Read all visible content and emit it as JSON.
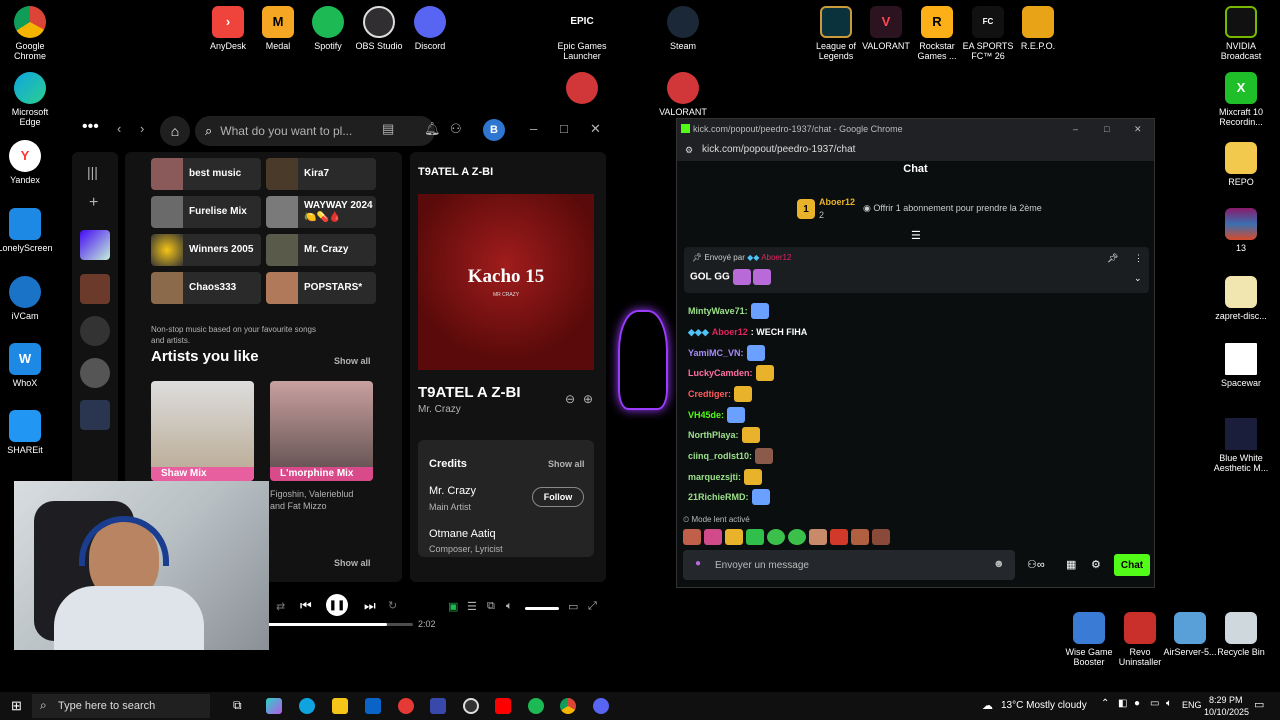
{
  "desktop": {
    "left_icons": [
      "Google Chrome",
      "Microsoft Edge",
      "Yandex",
      "LonelyScreen",
      "iVCam",
      "WhoX",
      "SHAREit"
    ],
    "top_icons": [
      "AnyDesk",
      "Medal",
      "Spotify",
      "OBS Studio",
      "Discord",
      "Epic Games Launcher",
      "Steam",
      "League of Legends",
      "VALORANT",
      "Rockstar Games ...",
      "EA SPORTS FC™ 26",
      "R.E.P.O."
    ],
    "mid_icons": [
      "VALORANT"
    ],
    "right_icons": [
      "NVIDIA Broadcast",
      "Mixcraft 10 Recordin...",
      "REPO",
      "13",
      "zapret-disc...",
      "Spacewar",
      "Blue White Aesthetic M..."
    ],
    "bottom_icons": [
      "Wise Game Booster",
      "Revo Uninstaller",
      "AirServer-5...",
      "Recycle Bin"
    ]
  },
  "spotify": {
    "search_placeholder": "What do you want to pl...",
    "avatar": "B",
    "grid": [
      "best music",
      "Kira7",
      "Furelise Mix",
      "WAYWAY 2024 🍋💊🩸",
      "Winners 2005",
      "Mr. Crazy",
      "Chaos333",
      "POPSTARS*"
    ],
    "subtext": "Non-stop music based on your favourite songs and artists.",
    "artists_heading": "Artists you like",
    "show_all": "Show all",
    "artist_mixes": [
      "Shaw Mix",
      "L'morphine Mix"
    ],
    "mix_desc": "Figoshin, Valerieblud and Fat Mizzo",
    "show_all_2": "Show all",
    "now_playing": {
      "header": "T9ATEL A Z-BI",
      "cover_text": "Kacho 15",
      "cover_sub": "MR CRAZY",
      "title": "T9ATEL A Z-BI",
      "artist": "Mr. Crazy"
    },
    "credits": {
      "heading": "Credits",
      "show_all": "Show all",
      "people": [
        {
          "name": "Mr. Crazy",
          "role": "Main Artist"
        },
        {
          "name": "Otmane Aatiq",
          "role": "Composer, Lyricist"
        }
      ],
      "follow": "Follow"
    },
    "player": {
      "elapsed": "2:02",
      "progress": 0.82
    }
  },
  "kick": {
    "window_title": "kick.com/popout/peedro-1937/chat - Google Chrome",
    "url": "kick.com/popout/peedro-1937/chat",
    "chat_heading": "Chat",
    "sub_user": "Aboer12",
    "sub_count": "2",
    "sub_badge": "1",
    "sub_offer": "Offrir 1 abonnement pour prendre la 2ème",
    "pinned_label": "Envoyé par",
    "pinned_user": "Aboer12",
    "pinned_msg": "GOL GG",
    "messages": [
      {
        "user": "MintyWave71:",
        "text": "",
        "color": "#9be18a"
      },
      {
        "user": "Aboer12",
        "text": ": WECH FIHA",
        "color": "#e0245e"
      },
      {
        "user": "YamiMC_VN:",
        "text": "",
        "color": "#a78bfa"
      },
      {
        "user": "LuckyCamden:",
        "text": "",
        "color": "#ff6fa0"
      },
      {
        "user": "Credtiger:",
        "text": "",
        "color": "#ff5c5c"
      },
      {
        "user": "VH45de:",
        "text": "",
        "color": "#53fc18"
      },
      {
        "user": "NorthPlaya:",
        "text": "",
        "color": "#9be18a"
      },
      {
        "user": "ciinq_rodlst10:",
        "text": "",
        "color": "#9be18a"
      },
      {
        "user": "marquezsjti:",
        "text": "",
        "color": "#9be18a"
      },
      {
        "user": "21RichieRMD:",
        "text": "",
        "color": "#9be18a"
      }
    ],
    "slow_mode": "Mode lent activé",
    "input_placeholder": "Envoyer un message",
    "send": "Chat"
  },
  "taskbar": {
    "search_placeholder": "Type here to search",
    "weather": "13°C  Mostly cloudy",
    "lang": "ENG",
    "time": "8:29 PM",
    "date": "10/10/2025"
  }
}
